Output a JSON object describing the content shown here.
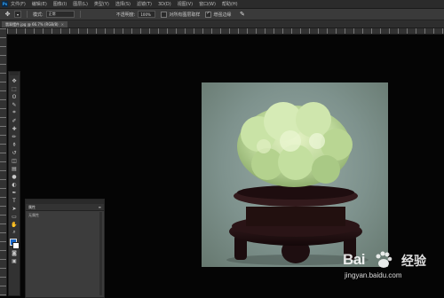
{
  "app": {
    "logo": "Ps",
    "menu": [
      "文件(F)",
      "编辑(E)",
      "图像(I)",
      "图层(L)",
      "类型(Y)",
      "选择(S)",
      "滤镜(T)",
      "3D(D)",
      "视图(V)",
      "窗口(W)",
      "帮助(H)"
    ]
  },
  "options": {
    "tool_icon": "move-tool-icon",
    "size_label": "模式:",
    "size_value": "正常",
    "opacity_label": "不透明度:",
    "opacity_value": "100%",
    "checkbox1_label": "对所有图层取样",
    "checkbox2_label": "增强边缘"
  },
  "document": {
    "tab_title": "翡翠摆件.jpg @ 66.7% (RGB/8)",
    "close": "×"
  },
  "toolbar": {
    "tools": [
      "move-tool-icon",
      "marquee-tool-icon",
      "lasso-tool-icon",
      "quick-select-icon",
      "crop-tool-icon",
      "eyedropper-icon",
      "healing-brush-icon",
      "brush-icon",
      "clone-stamp-icon",
      "history-brush-icon",
      "eraser-icon",
      "gradient-icon",
      "blur-icon",
      "dodge-icon",
      "pen-icon",
      "type-icon",
      "path-select-icon",
      "rectangle-icon",
      "hand-icon",
      "zoom-icon"
    ],
    "tool_glyphs": [
      "✥",
      "⬚",
      "ʘ",
      "✎",
      "⌗",
      "✐",
      "✚",
      "✏",
      "⚱",
      "↺",
      "◫",
      "▤",
      "●",
      "◐",
      "✒",
      "T",
      "➤",
      "▭",
      "✋",
      "⌕"
    ],
    "foreground_color": "#1563c5",
    "background_color": "#ffffff",
    "quickmask_glyph": "◙",
    "screenmode_glyph": "▣"
  },
  "panel": {
    "tab_label": "属性",
    "menu_glyph": "≡",
    "body_text": "无属性"
  },
  "canvas": {
    "image_subject": "jade-carving-on-wooden-stand"
  },
  "watermark": {
    "brand": "Bai",
    "brand_cn": "经验",
    "url": "jingyan.baidu.com"
  }
}
